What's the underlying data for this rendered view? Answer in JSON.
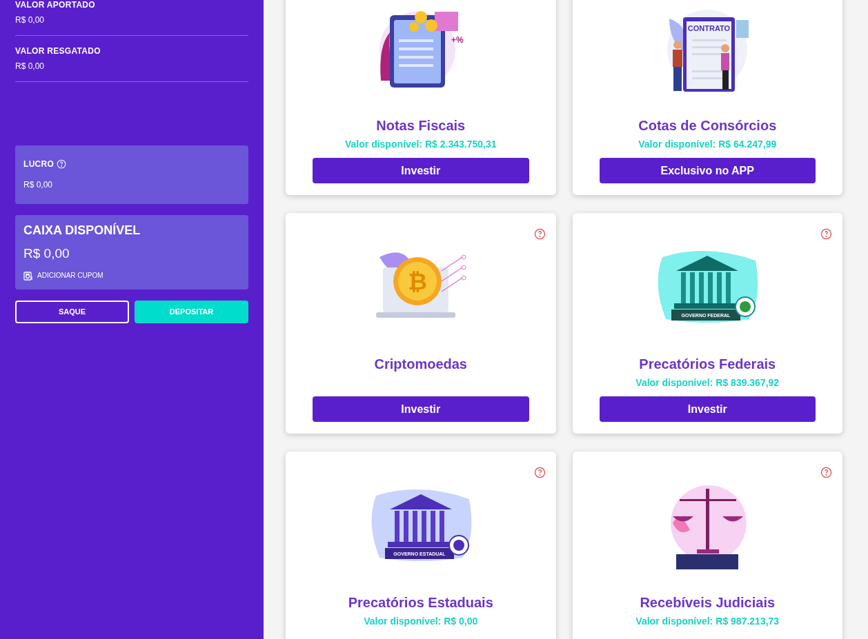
{
  "sidebar": {
    "summary": [
      {
        "label": "VALOR APORTADO",
        "value": "R$ 0,00"
      },
      {
        "label": "VALOR RESGATADO",
        "value": "R$ 0,00"
      }
    ],
    "profit": {
      "label": "LUCRO",
      "value": "R$ 0,00"
    },
    "cash": {
      "label": "CAIXA DISPONÍVEL",
      "value": "R$ 0,00",
      "coupon": "ADICIONAR CUPOM"
    },
    "buttons": [
      {
        "kind": "outline",
        "label": "SAQUE"
      },
      {
        "kind": "filled",
        "label": "DEPOSITAR"
      }
    ]
  },
  "products": [
    {
      "kind": "invoice",
      "title": "Notas Fiscais",
      "value": "Valor disponível: R$ 2.343.750,31",
      "button": "Investir",
      "illustration_label": "+%"
    },
    {
      "kind": "contract",
      "title": "Cotas de Consórcios",
      "value": "Valor disponível: R$ 64.247,99",
      "button": "Exclusivo no APP",
      "illustration_label": "CONTRATO"
    },
    {
      "kind": "bitcoin",
      "help": true,
      "title": "Criptomoedas",
      "button": "Investir",
      "illustration_label": "₿"
    },
    {
      "kind": "federal",
      "help": true,
      "title": "Precatórios Federais",
      "value": "Valor disponível: R$ 839.367,92",
      "button": "Investir",
      "illustration_label": "GOVERNO FEDERAL"
    },
    {
      "kind": "state",
      "help": true,
      "title": "Precatórios Estaduais",
      "value": "Valor disponível: R$ 0,00",
      "illustration_label": "GOVERNO ESTADUAL"
    },
    {
      "kind": "scale",
      "help": true,
      "title": "Recebíveis Judiciais",
      "value": "Valor disponível: R$ 987.213,73"
    }
  ]
}
